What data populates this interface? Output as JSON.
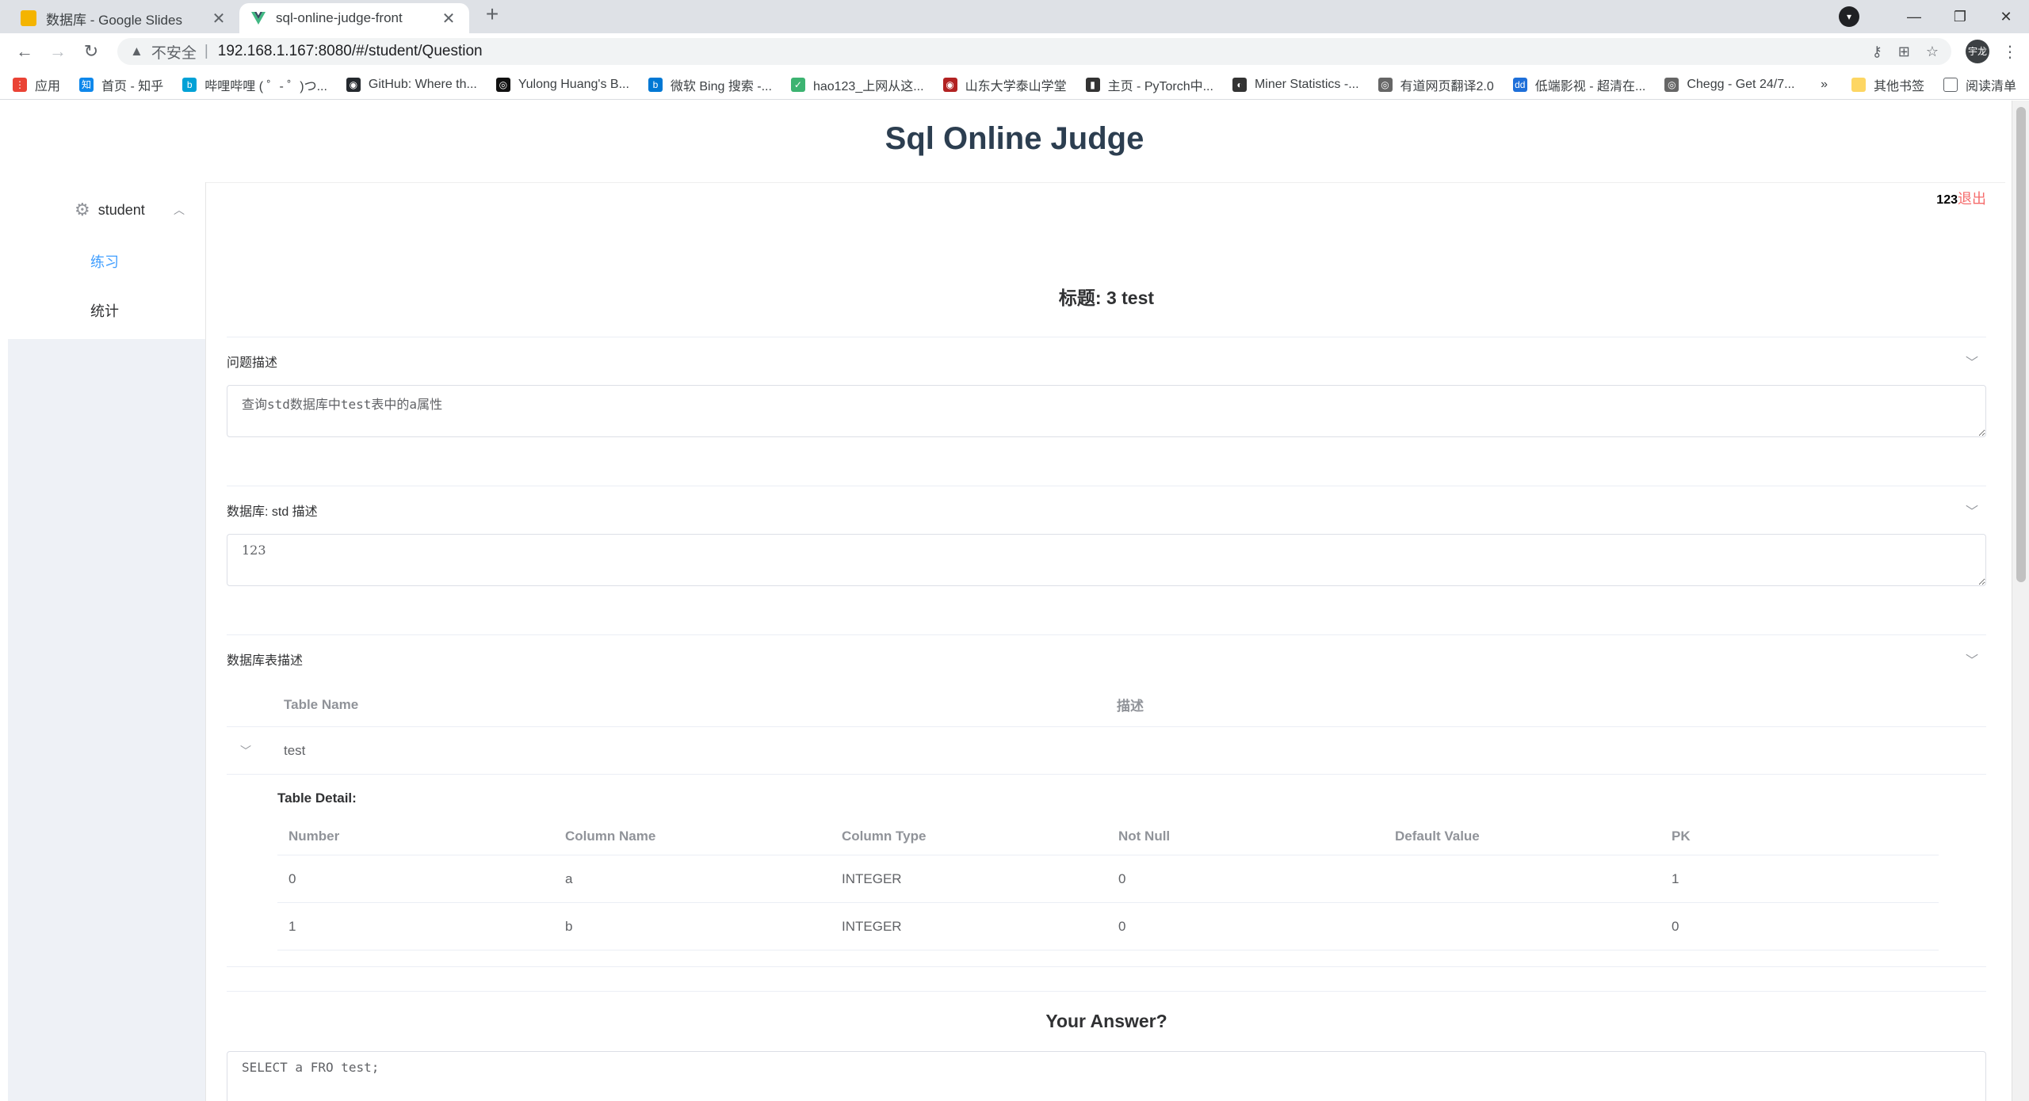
{
  "browser": {
    "tabs": [
      {
        "title": "数据库 - Google Slides",
        "favicon_color": "#f4b400",
        "active": false
      },
      {
        "title": "sql-online-judge-front",
        "favicon_color": "#41b883",
        "active": true
      }
    ],
    "new_tab": "+",
    "address": {
      "insecure_label": "不安全",
      "url": "192.168.1.167:8080/#/student/Question"
    },
    "profile_initials": "宇龙",
    "bookmarks": [
      {
        "label": "应用",
        "color": "#ea4335",
        "glyph": "⋮"
      },
      {
        "label": "首页 - 知乎",
        "color": "#0f88eb",
        "glyph": "知"
      },
      {
        "label": "哔哩哔哩 ( ゜- ゜)つ...",
        "color": "#00a1d6",
        "glyph": "b"
      },
      {
        "label": "GitHub: Where th...",
        "color": "#24292e",
        "glyph": "◉"
      },
      {
        "label": "Yulong Huang's B...",
        "color": "#111111",
        "glyph": "◎"
      },
      {
        "label": "微软 Bing 搜索 -...",
        "color": "#0078d4",
        "glyph": "b"
      },
      {
        "label": "hao123_上网从这...",
        "color": "#3cb371",
        "glyph": "✓"
      },
      {
        "label": "山东大学泰山学堂",
        "color": "#b22222",
        "glyph": "◉"
      },
      {
        "label": "主页 - PyTorch中...",
        "color": "#333333",
        "glyph": "▮"
      },
      {
        "label": "Miner Statistics -...",
        "color": "#333333",
        "glyph": "◐"
      },
      {
        "label": "有道网页翻译2.0",
        "color": "#666666",
        "glyph": "◎"
      },
      {
        "label": "低端影视 - 超清在...",
        "color": "#1e6fd9",
        "glyph": "dd"
      },
      {
        "label": "Chegg - Get 24/7...",
        "color": "#666666",
        "glyph": "◎"
      }
    ],
    "bookmarks_more": "»",
    "other_bookmarks": "其他书签",
    "reading_list": "阅读清单"
  },
  "app": {
    "title": "Sql Online Judge",
    "user": {
      "name": "123",
      "logout": "退出"
    },
    "sidebar": {
      "group": "student",
      "items": [
        {
          "label": "练习",
          "active": true
        },
        {
          "label": "统计",
          "active": false
        }
      ]
    },
    "question": {
      "title": "标题: 3 test",
      "desc_header": "问题描述",
      "desc_text": "查询std数据库中test表中的a属性",
      "db_header": "数据库: std 描述",
      "db_text": "123",
      "tables_header": "数据库表描述",
      "tables_columns": [
        "Table Name",
        "描述"
      ],
      "tables": [
        {
          "name": "test",
          "desc": ""
        }
      ],
      "detail_title": "Table Detail:",
      "detail_columns": [
        "Number",
        "Column Name",
        "Column Type",
        "Not Null",
        "Default Value",
        "PK"
      ],
      "detail_rows": [
        [
          "0",
          "a",
          "INTEGER",
          "0",
          "",
          "1"
        ],
        [
          "1",
          "b",
          "INTEGER",
          "0",
          "",
          "0"
        ]
      ]
    },
    "answer": {
      "title": "Your Answer?",
      "value": "SELECT a FRO test;"
    }
  },
  "colors": {
    "accent": "#409eff",
    "logout": "#f56c6c"
  }
}
